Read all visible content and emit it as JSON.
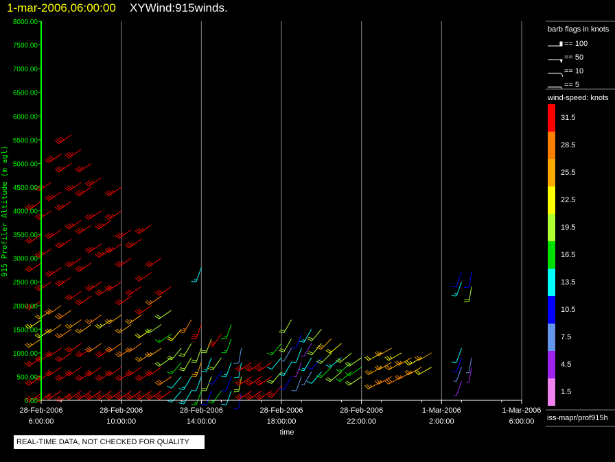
{
  "header": {
    "date": "1-mar-2006,06:00:00",
    "name": "XYWind:915winds."
  },
  "quality_note": "REAL-TIME DATA, NOT CHECKED FOR QUALITY",
  "source": "iss-mapr/prof915h",
  "barb_legend": {
    "title": "barb flags in knots",
    "items": [
      {
        "label": "== 100",
        "value": 100
      },
      {
        "label": "== 50",
        "value": 50
      },
      {
        "label": "== 10",
        "value": 10
      },
      {
        "label": "== 5",
        "value": 5
      }
    ]
  },
  "colorbar": {
    "title": "wind-speed: knots",
    "bins": [
      {
        "label": "31.5",
        "color": "#ff0000"
      },
      {
        "label": "28.5",
        "color": "#ff8000"
      },
      {
        "label": "25.5",
        "color": "#ffa800"
      },
      {
        "label": "22.5",
        "color": "#ffff00"
      },
      {
        "label": "19.5",
        "color": "#b0ff30"
      },
      {
        "label": "16.5",
        "color": "#00e000"
      },
      {
        "label": "13.5",
        "color": "#00ffff"
      },
      {
        "label": "10.5",
        "color": "#0000ff"
      },
      {
        "label": "7.5",
        "color": "#6495ed"
      },
      {
        "label": "4.5",
        "color": "#a020f0"
      },
      {
        "label": "1.5",
        "color": "#ee82ee"
      }
    ]
  },
  "chart_data": {
    "type": "wind-barb",
    "xlabel": "time",
    "ylabel": "915 Profiler Altitude (m agl)",
    "xlim": [
      "2006-02-28T06:00",
      "2006-03-01T06:00"
    ],
    "ylim": [
      0,
      8000
    ],
    "grid": "vertical",
    "xticks": [
      {
        "d": "28-Feb-2006",
        "t": "6:00:00"
      },
      {
        "d": "28-Feb-2006",
        "t": "10:00:00"
      },
      {
        "d": "28-Feb-2006",
        "t": "14:00:00"
      },
      {
        "d": "28-Feb-2006",
        "t": "18:00:00"
      },
      {
        "d": "28-Feb-2006",
        "t": "22:00:00"
      },
      {
        "d": "1-Mar-2006",
        "t": "2:00:00"
      },
      {
        "d": "1-Mar-2006",
        "t": "6:00:00"
      }
    ],
    "yticks": [
      "0.00",
      "500.00",
      "1000.00",
      "1500.00",
      "2000.00",
      "2500.00",
      "3000.00",
      "3500.00",
      "4000.00",
      "4500.00",
      "5000.00",
      "5500.00",
      "6000.00",
      "6500.00",
      "7000.00",
      "7500.00",
      "8000.00"
    ],
    "profiles": [
      {
        "t": "2006-02-28T06:00",
        "dir": 235,
        "levels": [
          [
            150,
            30
          ],
          [
            500,
            31
          ],
          [
            900,
            31
          ],
          [
            1300,
            25
          ],
          [
            1700,
            23
          ],
          [
            2100,
            31
          ],
          [
            2900,
            32
          ],
          [
            3500,
            32
          ],
          [
            4200,
            33
          ]
        ]
      },
      {
        "t": "2006-02-28T06:30",
        "dir": 235,
        "levels": [
          [
            150,
            31
          ],
          [
            600,
            32
          ],
          [
            1000,
            31
          ],
          [
            1500,
            22
          ],
          [
            1900,
            24
          ],
          [
            2500,
            33
          ],
          [
            3200,
            34
          ],
          [
            4000,
            35
          ],
          [
            4600,
            36
          ]
        ]
      },
      {
        "t": "2006-02-28T07:00",
        "dir": 235,
        "levels": [
          [
            200,
            32
          ],
          [
            700,
            32
          ],
          [
            1100,
            31
          ],
          [
            1600,
            26
          ],
          [
            2000,
            29
          ],
          [
            2800,
            34
          ],
          [
            3600,
            35
          ],
          [
            4400,
            36
          ],
          [
            5200,
            38
          ]
        ]
      },
      {
        "t": "2006-02-28T07:30",
        "dir": 235,
        "levels": [
          [
            150,
            31
          ],
          [
            600,
            32
          ],
          [
            1000,
            31
          ],
          [
            1500,
            27
          ],
          [
            1900,
            28
          ],
          [
            2600,
            34
          ],
          [
            3400,
            35
          ],
          [
            4200,
            36
          ],
          [
            5000,
            37
          ],
          [
            5600,
            38
          ]
        ]
      },
      {
        "t": "2006-02-28T08:00",
        "dir": 235,
        "levels": [
          [
            200,
            31
          ],
          [
            700,
            32
          ],
          [
            1200,
            30
          ],
          [
            1700,
            24
          ],
          [
            2300,
            32
          ],
          [
            3000,
            34
          ],
          [
            3800,
            35
          ],
          [
            4600,
            36
          ],
          [
            5300,
            37
          ]
        ]
      },
      {
        "t": "2006-02-28T08:30",
        "dir": 235,
        "levels": [
          [
            200,
            32
          ],
          [
            600,
            31
          ],
          [
            1100,
            31
          ],
          [
            1600,
            25
          ],
          [
            2200,
            31
          ],
          [
            2900,
            33
          ],
          [
            3700,
            35
          ],
          [
            4500,
            36
          ],
          [
            5000,
            36
          ]
        ]
      },
      {
        "t": "2006-02-28T09:00",
        "dir": 235,
        "levels": [
          [
            200,
            31
          ],
          [
            700,
            32
          ],
          [
            1200,
            29
          ],
          [
            1800,
            27
          ],
          [
            2500,
            33
          ],
          [
            3300,
            34
          ],
          [
            4000,
            35
          ],
          [
            4700,
            36
          ]
        ]
      },
      {
        "t": "2006-02-28T09:30",
        "dir": 235,
        "levels": [
          [
            200,
            31
          ],
          [
            600,
            32
          ],
          [
            1100,
            30
          ],
          [
            1700,
            23
          ],
          [
            2400,
            32
          ],
          [
            3200,
            33
          ],
          [
            3800,
            34
          ]
        ]
      },
      {
        "t": "2006-02-28T10:00",
        "dir": 235,
        "levels": [
          [
            200,
            32
          ],
          [
            700,
            31
          ],
          [
            1200,
            29
          ],
          [
            1800,
            26
          ],
          [
            2500,
            32
          ],
          [
            3300,
            33
          ],
          [
            4000,
            34
          ],
          [
            4500,
            35
          ]
        ]
      },
      {
        "t": "2006-02-28T10:30",
        "dir": 235,
        "levels": [
          [
            200,
            32
          ],
          [
            600,
            31
          ],
          [
            1100,
            28
          ],
          [
            1600,
            24
          ],
          [
            2200,
            31
          ],
          [
            3000,
            33
          ],
          [
            3600,
            34
          ]
        ]
      },
      {
        "t": "2006-02-28T11:00",
        "dir": 235,
        "levels": [
          [
            200,
            31
          ],
          [
            700,
            31
          ],
          [
            1200,
            27
          ],
          [
            1800,
            25
          ],
          [
            2400,
            32
          ],
          [
            3400,
            33
          ]
        ]
      },
      {
        "t": "2006-02-28T11:30",
        "dir": 235,
        "levels": [
          [
            200,
            31
          ],
          [
            600,
            30
          ],
          [
            1000,
            26
          ],
          [
            1500,
            21
          ],
          [
            2000,
            31
          ],
          [
            2700,
            31
          ],
          [
            3700,
            33
          ]
        ]
      },
      {
        "t": "2006-02-28T12:00",
        "dir": 235,
        "levels": [
          [
            200,
            31
          ],
          [
            700,
            30
          ],
          [
            1100,
            25
          ],
          [
            1600,
            18
          ],
          [
            2200,
            27
          ],
          [
            3000,
            31
          ]
        ]
      },
      {
        "t": "2006-02-28T12:30",
        "dir": 235,
        "levels": [
          [
            200,
            31
          ],
          [
            500,
            29
          ],
          [
            900,
            20
          ],
          [
            1400,
            17
          ],
          [
            1900,
            20
          ],
          [
            2400,
            30
          ]
        ]
      },
      {
        "t": "2006-02-28T13:00",
        "dir": 220,
        "levels": [
          [
            200,
            14
          ],
          [
            500,
            12
          ],
          [
            800,
            16
          ],
          [
            1100,
            19
          ],
          [
            1500,
            22
          ]
        ]
      },
      {
        "t": "2006-02-28T13:30",
        "dir": 210,
        "levels": [
          [
            200,
            13
          ],
          [
            500,
            14
          ],
          [
            900,
            20
          ],
          [
            1200,
            18
          ],
          [
            1700,
            27
          ]
        ]
      },
      {
        "t": "2006-02-28T14:00",
        "dir": 200,
        "levels": [
          [
            200,
            15
          ],
          [
            500,
            12
          ],
          [
            800,
            25
          ],
          [
            1100,
            19
          ],
          [
            1600,
            30
          ],
          [
            2800,
            13
          ]
        ]
      },
      {
        "t": "2006-02-28T14:30",
        "dir": 200,
        "levels": [
          [
            200,
            10
          ],
          [
            500,
            18
          ],
          [
            900,
            14
          ],
          [
            1300,
            20
          ]
        ]
      },
      {
        "t": "2006-02-28T15:00",
        "dir": 215,
        "levels": [
          [
            200,
            16
          ],
          [
            600,
            11
          ],
          [
            900,
            20
          ],
          [
            1400,
            31
          ]
        ]
      },
      {
        "t": "2006-02-28T15:30",
        "dir": 200,
        "levels": [
          [
            200,
            12
          ],
          [
            500,
            9
          ],
          [
            800,
            14
          ],
          [
            1300,
            15
          ],
          [
            1600,
            17
          ]
        ]
      },
      {
        "t": "2006-02-28T16:00",
        "dir": 190,
        "levels": [
          [
            150,
            10
          ],
          [
            500,
            19
          ],
          [
            800,
            12
          ],
          [
            1100,
            8
          ]
        ]
      },
      {
        "t": "2006-02-28T16:30",
        "dir": 235,
        "levels": [
          [
            200,
            31
          ],
          [
            500,
            31
          ],
          [
            800,
            31
          ]
        ]
      },
      {
        "t": "2006-02-28T17:00",
        "dir": 235,
        "levels": [
          [
            200,
            31
          ],
          [
            500,
            31
          ],
          [
            800,
            30
          ]
        ]
      },
      {
        "t": "2006-02-28T17:30",
        "dir": 235,
        "levels": [
          [
            200,
            31
          ],
          [
            500,
            31
          ],
          [
            800,
            32
          ]
        ]
      },
      {
        "t": "2006-02-28T18:00",
        "dir": 220,
        "levels": [
          [
            300,
            31
          ],
          [
            600,
            20
          ],
          [
            900,
            12
          ],
          [
            1200,
            16
          ]
        ]
      },
      {
        "t": "2006-02-28T18:30",
        "dir": 210,
        "levels": [
          [
            500,
            9
          ],
          [
            800,
            13
          ],
          [
            1100,
            7
          ],
          [
            1300,
            19
          ],
          [
            1700,
            20
          ]
        ]
      },
      {
        "t": "2006-02-28T19:00",
        "dir": 200,
        "levels": [
          [
            500,
            8
          ],
          [
            800,
            5
          ],
          [
            1100,
            12
          ],
          [
            1400,
            10
          ]
        ]
      },
      {
        "t": "2006-02-28T19:30",
        "dir": 210,
        "levels": [
          [
            600,
            7
          ],
          [
            900,
            14
          ],
          [
            1200,
            5
          ],
          [
            1500,
            13
          ]
        ]
      },
      {
        "t": "2006-02-28T20:00",
        "dir": 220,
        "levels": [
          [
            600,
            12
          ],
          [
            900,
            10
          ],
          [
            1200,
            20
          ],
          [
            1500,
            18
          ]
        ]
      },
      {
        "t": "2006-02-28T20:30",
        "dir": 225,
        "levels": [
          [
            700,
            15
          ],
          [
            1000,
            20
          ],
          [
            1300,
            25
          ]
        ]
      },
      {
        "t": "2006-02-28T21:00",
        "dir": 230,
        "levels": [
          [
            600,
            18
          ],
          [
            900,
            13
          ],
          [
            1200,
            22
          ]
        ]
      },
      {
        "t": "2006-02-28T21:30",
        "dir": 230,
        "levels": [
          [
            600,
            16
          ],
          [
            800,
            17
          ],
          [
            1000,
            20
          ]
        ]
      },
      {
        "t": "2006-02-28T22:00",
        "dir": 235,
        "levels": [
          [
            500,
            20
          ],
          [
            700,
            17
          ],
          [
            900,
            18
          ]
        ]
      },
      {
        "t": "2006-02-28T23:00",
        "dir": 240,
        "levels": [
          [
            400,
            26
          ],
          [
            700,
            25
          ],
          [
            1000,
            22
          ]
        ]
      },
      {
        "t": "2006-02-28T23:30",
        "dir": 240,
        "levels": [
          [
            500,
            27
          ],
          [
            800,
            26
          ],
          [
            1100,
            24
          ]
        ]
      },
      {
        "t": "2006-03-01T00:00",
        "dir": 240,
        "levels": [
          [
            500,
            28
          ],
          [
            800,
            25
          ],
          [
            1000,
            23
          ]
        ]
      },
      {
        "t": "2006-03-01T00:30",
        "dir": 240,
        "levels": [
          [
            600,
            27
          ],
          [
            900,
            24
          ]
        ]
      },
      {
        "t": "2006-03-01T01:00",
        "dir": 240,
        "levels": [
          [
            700,
            25
          ],
          [
            900,
            23
          ]
        ]
      },
      {
        "t": "2006-03-01T01:30",
        "dir": 240,
        "levels": [
          [
            700,
            22
          ],
          [
            1000,
            24
          ]
        ]
      },
      {
        "t": "2006-03-01T03:00",
        "dir": 200,
        "levels": [
          [
            400,
            5
          ],
          [
            700,
            7
          ],
          [
            900,
            10
          ],
          [
            1100,
            12
          ],
          [
            2500,
            14
          ],
          [
            2700,
            9
          ]
        ]
      },
      {
        "t": "2006-03-01T03:30",
        "dir": 190,
        "levels": [
          [
            700,
            4
          ],
          [
            900,
            6
          ],
          [
            2400,
            18
          ],
          [
            2700,
            11
          ]
        ]
      }
    ]
  }
}
